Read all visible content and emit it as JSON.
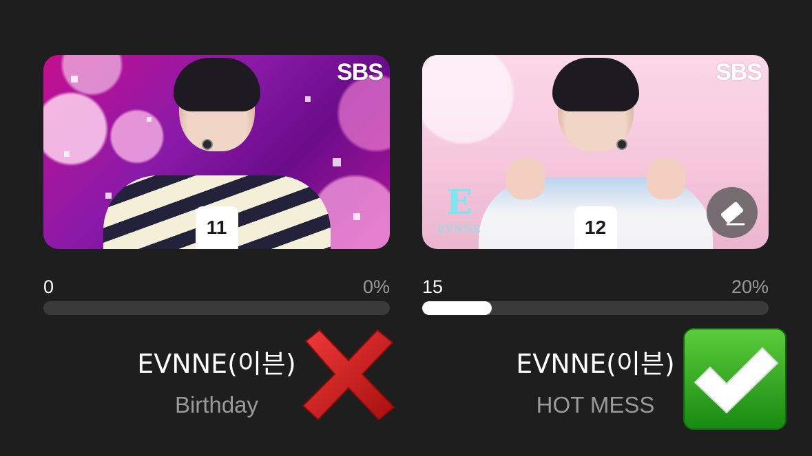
{
  "colors": {
    "background": "#1e1e1e",
    "bar_track": "#3a3a3a",
    "bar_fill": "#ffffff",
    "cross_red": "#d81c1c",
    "check_green": "#2faa1c"
  },
  "options": [
    {
      "broadcaster_logo": "SBS",
      "number": "11",
      "count": "0",
      "percent": "0%",
      "percent_value": 0,
      "artist": "EVNNE(이븐)",
      "song": "Birthday",
      "result_icon": "red-cross-icon"
    },
    {
      "broadcaster_logo": "SBS",
      "group_logo_text": "EVNNE",
      "number": "12",
      "count": "15",
      "percent": "20%",
      "percent_value": 20,
      "artist": "EVNNE(이븐)",
      "song": "HOT MESS",
      "result_icon": "green-check-icon",
      "corner_icon": "eraser-icon"
    }
  ]
}
